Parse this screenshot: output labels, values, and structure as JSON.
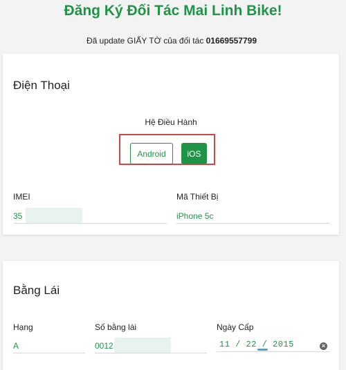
{
  "header": {
    "title": "Đăng Ký Đối Tác Mai Linh Bike!",
    "subtitle_prefix": "Đã update GIẤY TỜ của đối tác",
    "partner_phone": "01669557799"
  },
  "phone_section": {
    "title": "Điện Thoại",
    "os_label": "Hệ Điều Hành",
    "os_options": [
      "Android",
      "iOS"
    ],
    "selected_os": "iOS",
    "imei_label": "IMEI",
    "imei_value": "35",
    "device_label": "Mã Thiết Bị",
    "device_value": "iPhone 5c"
  },
  "license_section": {
    "title": "Bằng Lái",
    "class_label": "Hạng",
    "class_value": "A",
    "number_label": "Số bằng lái",
    "number_value": "0012",
    "issue_date_label": "Ngày Cấp",
    "issue_date_value": "11 / 22 / 2015"
  },
  "colors": {
    "brand_green": "#1f9447",
    "highlight_red": "#d64545"
  },
  "icons": {
    "clear_date": "clear-icon"
  }
}
